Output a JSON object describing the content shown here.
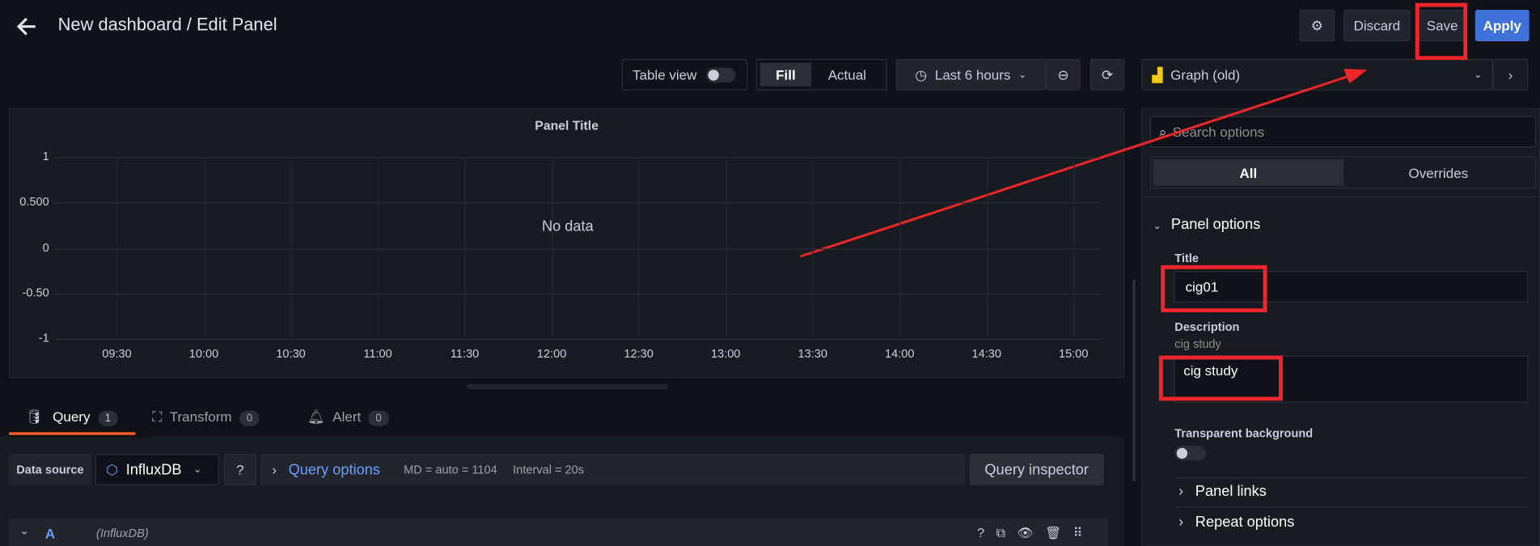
{
  "header": {
    "title": "New dashboard / Edit Panel",
    "discard": "Discard",
    "save": "Save",
    "apply": "Apply"
  },
  "toolbar": {
    "table_view": "Table view",
    "fill": "Fill",
    "actual": "Actual",
    "time_range": "Last 6 hours",
    "visualization": "Graph (old)"
  },
  "panel": {
    "title": "Panel Title",
    "no_data": "No data"
  },
  "chart_data": {
    "type": "line",
    "title": "Panel Title",
    "yticks": [
      "1",
      "0.500",
      "0",
      "-0.50",
      "-1"
    ],
    "ylim": [
      -1,
      1
    ],
    "xticks": [
      "09:30",
      "10:00",
      "10:30",
      "11:00",
      "11:30",
      "12:00",
      "12:30",
      "13:00",
      "13:30",
      "14:00",
      "14:30",
      "15:00"
    ],
    "series": [],
    "annotation": "No data",
    "grid": true
  },
  "tabs": [
    {
      "label": "Query",
      "count": "1"
    },
    {
      "label": "Transform",
      "count": "0"
    },
    {
      "label": "Alert",
      "count": "0"
    }
  ],
  "query": {
    "datasource_label": "Data source",
    "datasource": "InfluxDB",
    "options": "Query options",
    "md": "MD = auto = 1104",
    "interval": "Interval = 20s",
    "inspector": "Query inspector",
    "row_letter": "A",
    "row_source": "(InfluxDB)"
  },
  "options": {
    "search_placeholder": "Search options",
    "all": "All",
    "overrides": "Overrides",
    "panel_options": "Panel options",
    "title_label": "Title",
    "title_value": "cig01",
    "description_label": "Description",
    "description_hint": "cig study",
    "description_value": "cig study",
    "transparent_label": "Transparent background",
    "transparent": false,
    "panel_links": "Panel links",
    "repeat_options": "Repeat options"
  },
  "colors": {
    "accent": "#3d71d9",
    "tab_active": "#f05a28",
    "link": "#6e9fff",
    "annotation": "#f0262d"
  }
}
